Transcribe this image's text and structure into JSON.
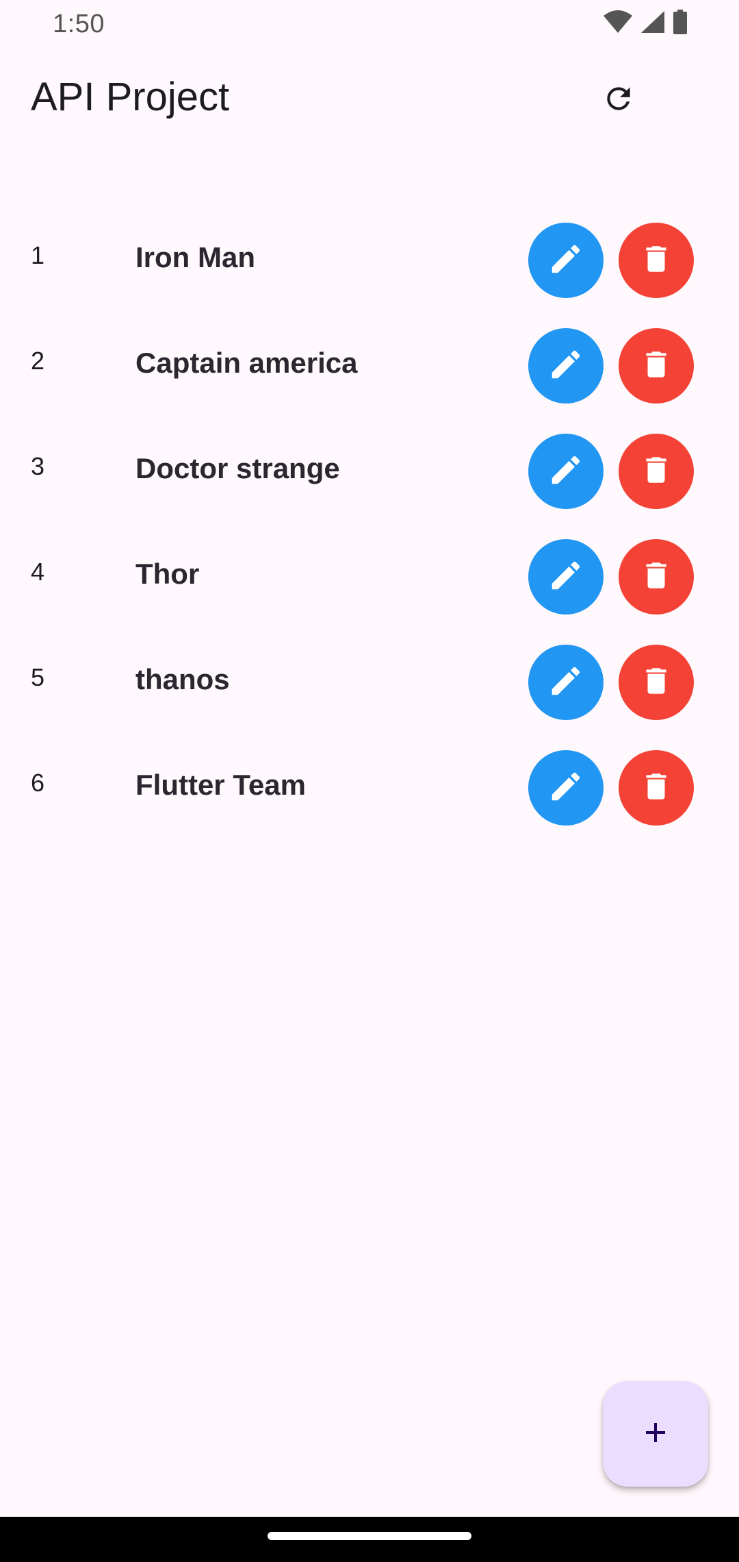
{
  "status_bar": {
    "time": "1:50",
    "icons": [
      "wifi-icon",
      "signal-icon",
      "battery-icon"
    ]
  },
  "app_bar": {
    "title": "API Project",
    "actions": [
      "refresh-icon"
    ]
  },
  "list": {
    "items": [
      {
        "index": "1",
        "name": "Iron Man"
      },
      {
        "index": "2",
        "name": "Captain america"
      },
      {
        "index": "3",
        "name": "Doctor strange"
      },
      {
        "index": "4",
        "name": "Thor"
      },
      {
        "index": "5",
        "name": "thanos"
      },
      {
        "index": "6",
        "name": "Flutter Team"
      }
    ],
    "edit_icon": "pencil-icon",
    "delete_icon": "trash-icon"
  },
  "fab": {
    "icon": "plus-icon"
  },
  "colors": {
    "background": "#FFF8FC",
    "edit_button": "#2196F3",
    "delete_button": "#F44336",
    "fab_background": "#EADDFF",
    "fab_icon": "#21005D",
    "text_primary": "#1C1B1F"
  }
}
